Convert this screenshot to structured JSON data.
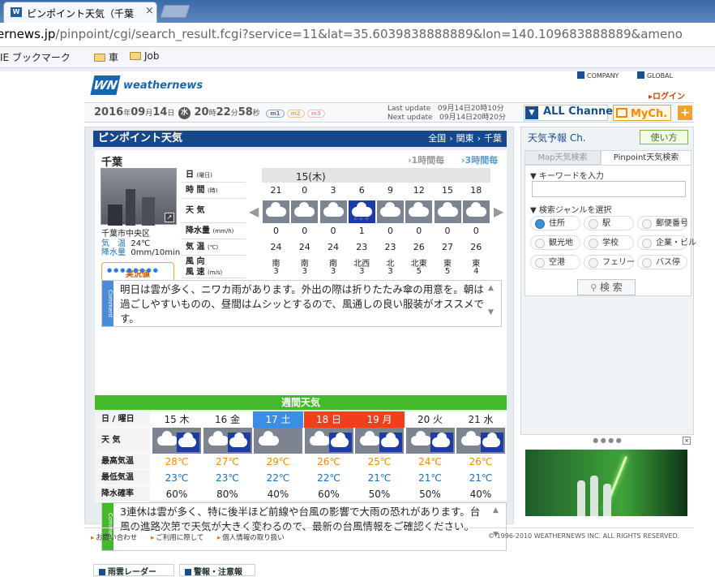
{
  "browser": {
    "tab_title": "ピンポイント天気（千葉",
    "tab_close": "×",
    "url_domain": "ernews.jp",
    "url_path": "/pinpoint/cgi/search_result.fcgi?service=11&lat=35.6039838888889&lon=140.109683888889&ameno",
    "bookmarks": [
      "IE ブックマーク",
      "車",
      "Job"
    ]
  },
  "header": {
    "logo_mark": "WN",
    "logo_text": "weathernews",
    "links": [
      "COMPANY",
      "GLOBAL"
    ],
    "login": "ログイン"
  },
  "infobar": {
    "year": "2016",
    "year_unit": "年",
    "month": "09",
    "month_unit": "月",
    "day": "14",
    "day_unit": "日",
    "weekday": "水",
    "hour": "20",
    "hour_unit": "時",
    "minute": "22",
    "minute_unit": "分",
    "second": "58",
    "second_unit": "秒",
    "pills": [
      "m1",
      "m2",
      "m3"
    ],
    "last_update_label": "Last update",
    "last_update": "09月14日20時10分",
    "next_update_label": "Next update",
    "next_update": "09月14日20時20分",
    "all_channel": "ALL Channel",
    "mych": "MyCh.",
    "plus": "+"
  },
  "panel": {
    "title": "ピンポイント天気",
    "nav": [
      "全国",
      "関東",
      "千葉"
    ],
    "nav_sep": "›",
    "place": "千葉",
    "link_1h": "1時間毎",
    "link_3h": "3時間毎",
    "station": "千葉市中央区",
    "temp_label": "気　温",
    "temp_value": "24℃",
    "rain_label": "降水量",
    "rain_value": "0mm/10min",
    "jikkyo": "実況値",
    "labels": {
      "date": "日",
      "date_u": "(曜日)",
      "time": "時 間",
      "time_u": "(時)",
      "weather": "天 気",
      "precip": "降水量",
      "precip_u": "(mm/h)",
      "temp": "気 温",
      "temp_u": "(℃)",
      "wind_dir": "風 向",
      "wind_speed": "風 速",
      "wind_speed_u": "(m/s)"
    },
    "date_head": "15(木)",
    "hours": [
      "21",
      "0",
      "3",
      "6",
      "9",
      "12",
      "15",
      "18"
    ],
    "weather": [
      "cloud",
      "cloud",
      "cloud",
      "rain",
      "cloud",
      "cloud",
      "cloud",
      "cloud"
    ],
    "precip": [
      "0",
      "0",
      "0",
      "1",
      "0",
      "0",
      "0",
      "0"
    ],
    "temp": [
      "24",
      "24",
      "24",
      "23",
      "23",
      "26",
      "27",
      "26"
    ],
    "wind_dir": [
      "南",
      "南",
      "南",
      "北西",
      "北",
      "北東",
      "東",
      "東"
    ],
    "wind_speed": [
      "3",
      "3",
      "3",
      "3",
      "3",
      "5",
      "5",
      "4"
    ],
    "comment_badge": "Comment",
    "comment": "明日は雲が多く、ニワカ雨があります。外出の際は折りたたみ傘の用意を。朝は過ごしやすいものの、昼間はムシッとするので、風通しの良い服装がオススメです。",
    "week_title": "週間天気",
    "week_labels": {
      "day": "日 / 曜日",
      "weather": "天 気",
      "high": "最高気温",
      "low": "最低気温",
      "rain": "降水確率"
    },
    "week": [
      {
        "day": "15 木",
        "high": "28℃",
        "low": "23℃",
        "rain": "60%",
        "bg": "#ffffff",
        "fg": "#222222"
      },
      {
        "day": "16 金",
        "high": "27℃",
        "low": "23℃",
        "rain": "80%",
        "bg": "#ffffff",
        "fg": "#222222"
      },
      {
        "day": "17 土",
        "high": "29℃",
        "low": "22℃",
        "rain": "40%",
        "bg": "#3a8ee6",
        "fg": "#ffffff"
      },
      {
        "day": "18 日",
        "high": "26℃",
        "low": "22℃",
        "rain": "60%",
        "bg": "#f0401a",
        "fg": "#ffffff"
      },
      {
        "day": "19 月",
        "high": "25℃",
        "low": "21℃",
        "rain": "50%",
        "bg": "#f0401a",
        "fg": "#ffffff"
      },
      {
        "day": "20 火",
        "high": "24℃",
        "low": "21℃",
        "rain": "50%",
        "bg": "#ffffff",
        "fg": "#222222"
      },
      {
        "day": "21 水",
        "high": "26℃",
        "low": "21℃",
        "rain": "40%",
        "bg": "#ffffff",
        "fg": "#222222"
      }
    ],
    "week_comment": "3連休は雲が多く、特に後半ほど前線や台風の影響で大雨の恐れがあります。台風の進路次第で天気が大きく変わるので、最新の台風情報をご確認ください。",
    "bottom_tabs": [
      "雨雲レーダー",
      "警報・注意報"
    ]
  },
  "right": {
    "title": "天気予報 Ch.",
    "usage": "使い方",
    "tab_map": "Map天気検索",
    "tab_pinpoint": "Pinpoint天気検索",
    "keyword_label": "▼ キーワードを入力",
    "genre_label": "▼ 検索ジャンルを選択",
    "genres": [
      "住所",
      "駅",
      "郵便番号",
      "観光地",
      "学校",
      "企業・ビル",
      "空港",
      "フェリー",
      "バス停"
    ],
    "search_btn": "検 索",
    "dots": "● ● ● ●"
  },
  "footer": {
    "links": [
      "お問い合わせ",
      "ご利用に際して",
      "個人情報の取り扱い"
    ],
    "copyright": "© 1996-2010 WEATHERNEWS INC. ALL RIGHTS RESERVED."
  },
  "colors": {
    "brand": "#17498a",
    "accent": "#f08a00",
    "week_green": "#45b82c"
  }
}
